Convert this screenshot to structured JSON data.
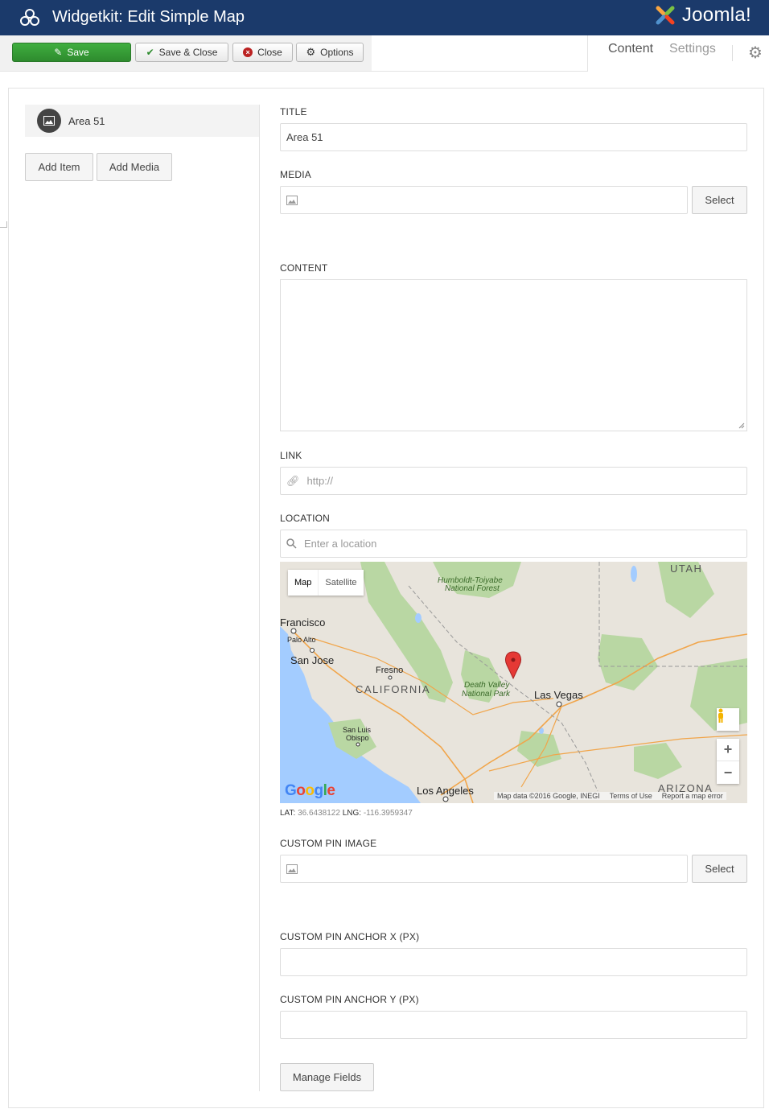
{
  "header": {
    "title": "Widgetkit: Edit Simple Map",
    "brand": "Joomla!"
  },
  "toolbar": {
    "save": "Save",
    "save_close": "Save & Close",
    "close": "Close",
    "options": "Options"
  },
  "tabs": [
    {
      "label": "Content",
      "active": true
    },
    {
      "label": "Settings",
      "active": false
    }
  ],
  "sidebar": {
    "items": [
      {
        "label": "Area 51"
      }
    ],
    "add_item": "Add Item",
    "add_media": "Add Media"
  },
  "form": {
    "title_label": "TITLE",
    "title_value": "Area 51",
    "media_label": "MEDIA",
    "select": "Select",
    "content_label": "CONTENT",
    "link_label": "LINK",
    "link_placeholder": "http://",
    "location_label": "LOCATION",
    "location_placeholder": "Enter a location",
    "lat_label": "LAT:",
    "lat_value": "36.6438122",
    "lng_label": "LNG:",
    "lng_value": "-116.3959347",
    "custom_pin_image_label": "CUSTOM PIN IMAGE",
    "anchor_x_label": "CUSTOM PIN ANCHOR X (PX)",
    "anchor_y_label": "CUSTOM PIN ANCHOR Y (PX)",
    "manage_fields": "Manage Fields"
  },
  "map": {
    "type_map": "Map",
    "type_satellite": "Satellite",
    "labels": {
      "francisco": "Francisco",
      "palo_alto": "Palo Alto",
      "san_jose": "San Jose",
      "fresno": "Fresno",
      "california": "CALIFORNIA",
      "humboldt": "Humboldt-Toiyabe",
      "national_forest": "National Forest",
      "death_valley": "Death Valley",
      "national_park": "National Park",
      "las_vegas": "Las Vegas",
      "utah": "UTAH",
      "san_luis": "San Luis",
      "obispo": "Obispo",
      "los_angeles": "Los Angeles",
      "arizona": "ARIZONA"
    },
    "google": "Google",
    "attribution": "Map data ©2016 Google, INEGI",
    "terms": "Terms of Use",
    "report": "Report a map error"
  },
  "colors": {
    "header_bg": "#1b3a6b",
    "save_green": "#2e8b2e",
    "map_water": "#a3ccff",
    "map_land": "#e8e4dc",
    "map_forest": "#b9d7a3",
    "map_road": "#f1a54a",
    "pin": "#e53935"
  }
}
